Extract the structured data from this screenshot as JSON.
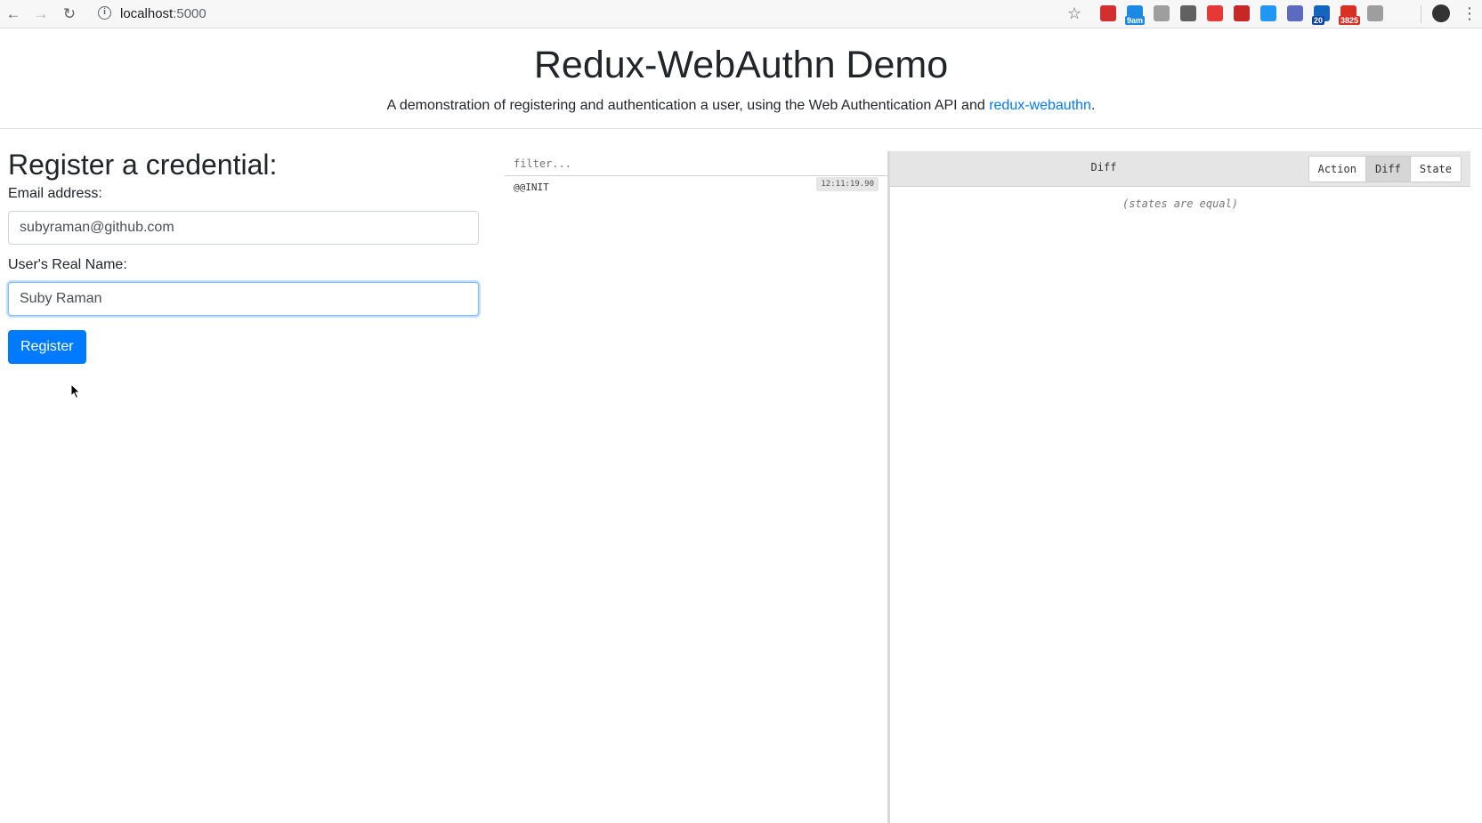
{
  "browser": {
    "url_host": "localhost",
    "url_port": ":5000",
    "extensions": [
      {
        "name": "lastpass-icon",
        "color": "#d32f2f",
        "badge": ""
      },
      {
        "name": "calendar-icon",
        "color": "#1e88e5",
        "badge": "9am"
      },
      {
        "name": "extension-icon",
        "color": "#9e9e9e",
        "badge": ""
      },
      {
        "name": "ublock-icon",
        "color": "#616161",
        "badge": ""
      },
      {
        "name": "adblock-icon",
        "color": "#e53935",
        "badge": ""
      },
      {
        "name": "redux-devtools-icon",
        "color": "#c62828",
        "badge": ""
      },
      {
        "name": "zoom-icon",
        "color": "#2196f3",
        "badge": ""
      },
      {
        "name": "globe-icon",
        "color": "#5c6bc0",
        "badge": ""
      },
      {
        "name": "home-icon",
        "color": "#1565c0",
        "badge": "20"
      },
      {
        "name": "gmail-icon",
        "color": "#d93025",
        "badge": "3825"
      },
      {
        "name": "camera-icon",
        "color": "#9e9e9e",
        "badge": ""
      }
    ]
  },
  "header": {
    "title": "Redux-WebAuthn Demo",
    "subtitle_text": "A demonstration of registering and authentication a user, using the Web Authentication API and ",
    "subtitle_link": "redux-webauthn",
    "subtitle_end": "."
  },
  "form": {
    "heading": "Register a credential:",
    "email_label": "Email address:",
    "email_value": "subyraman@github.com",
    "name_label": "User's Real Name:",
    "name_value": "Suby Raman",
    "register_label": "Register"
  },
  "devtools": {
    "filter_placeholder": "filter...",
    "actions": [
      {
        "type": "@@INIT",
        "time": "12:11:19.90"
      }
    ],
    "diff_title": "Diff",
    "tabs": [
      "Action",
      "Diff",
      "State"
    ],
    "active_tab": "Diff",
    "diff_message": "(states are equal)"
  }
}
